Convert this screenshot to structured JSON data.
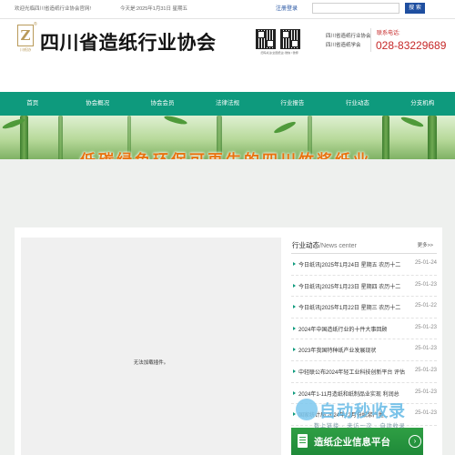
{
  "topbar": {
    "welcome": "欢迎光临四川省造纸行业协会官网!",
    "date": "今天是:2025年1月31日 星期五",
    "register": "注册",
    "login": "登录",
    "search_placeholder": "",
    "search_button": "搜 索"
  },
  "header": {
    "logo_mark": "Z",
    "logo_sub": "川纸协",
    "logo_icon": "zhi-logo-icon",
    "title": "四川省造纸行业协会",
    "qr_caption": "扫码关注(全国纸业) 微信 / 微博",
    "org_lines": [
      "四川省造纸行业协会",
      "四川省造纸学会"
    ],
    "contact_label": "联系电话:",
    "phone": "028-83229689"
  },
  "nav": {
    "items": [
      "首页",
      "协会概况",
      "协会会员",
      "法律法规",
      "行业报告",
      "行业动态",
      "分支机构"
    ]
  },
  "banner": {
    "slogan": "低碳绿色环保可再生的四川竹浆纸业"
  },
  "media": {
    "message": "无法加载插件。"
  },
  "news": {
    "title": "行业动态",
    "title_en": "/News center",
    "more": "更多>>",
    "items": [
      {
        "title": "今日纸讯|2025年1月24日 星期五 农历十二",
        "date": "25-01-24"
      },
      {
        "title": "今日纸讯|2025年1月23日 星期四 农历十二",
        "date": "25-01-23"
      },
      {
        "title": "今日纸讯|2025年1月22日 星期三 农历十二",
        "date": "25-01-22"
      },
      {
        "title": "2024年中国造纸行业的十件大事回顾",
        "date": "25-01-23"
      },
      {
        "title": "2023年我国特种纸产业发展现状",
        "date": "25-01-23"
      },
      {
        "title": "中轻联公布2024年轻工业科技创新平台 评估",
        "date": "25-01-23"
      },
      {
        "title": "2024年1-11月造纸和纸制品业实现 利润总",
        "date": "25-01-23"
      },
      {
        "title": "国家统计局:2024年12月份纸浆产量...",
        "date": "25-01-23"
      }
    ]
  },
  "platform": {
    "label": "造纸企业信息平台",
    "icon": "document-icon"
  },
  "watermark": {
    "text": "自动秒收录",
    "sub": "数上链接 · 来访一次 · 自动收录"
  },
  "colors": {
    "nav": "#0e9a7d",
    "phone": "#c62828",
    "slogan": "#e8730f",
    "platform": "#2f9f44"
  }
}
